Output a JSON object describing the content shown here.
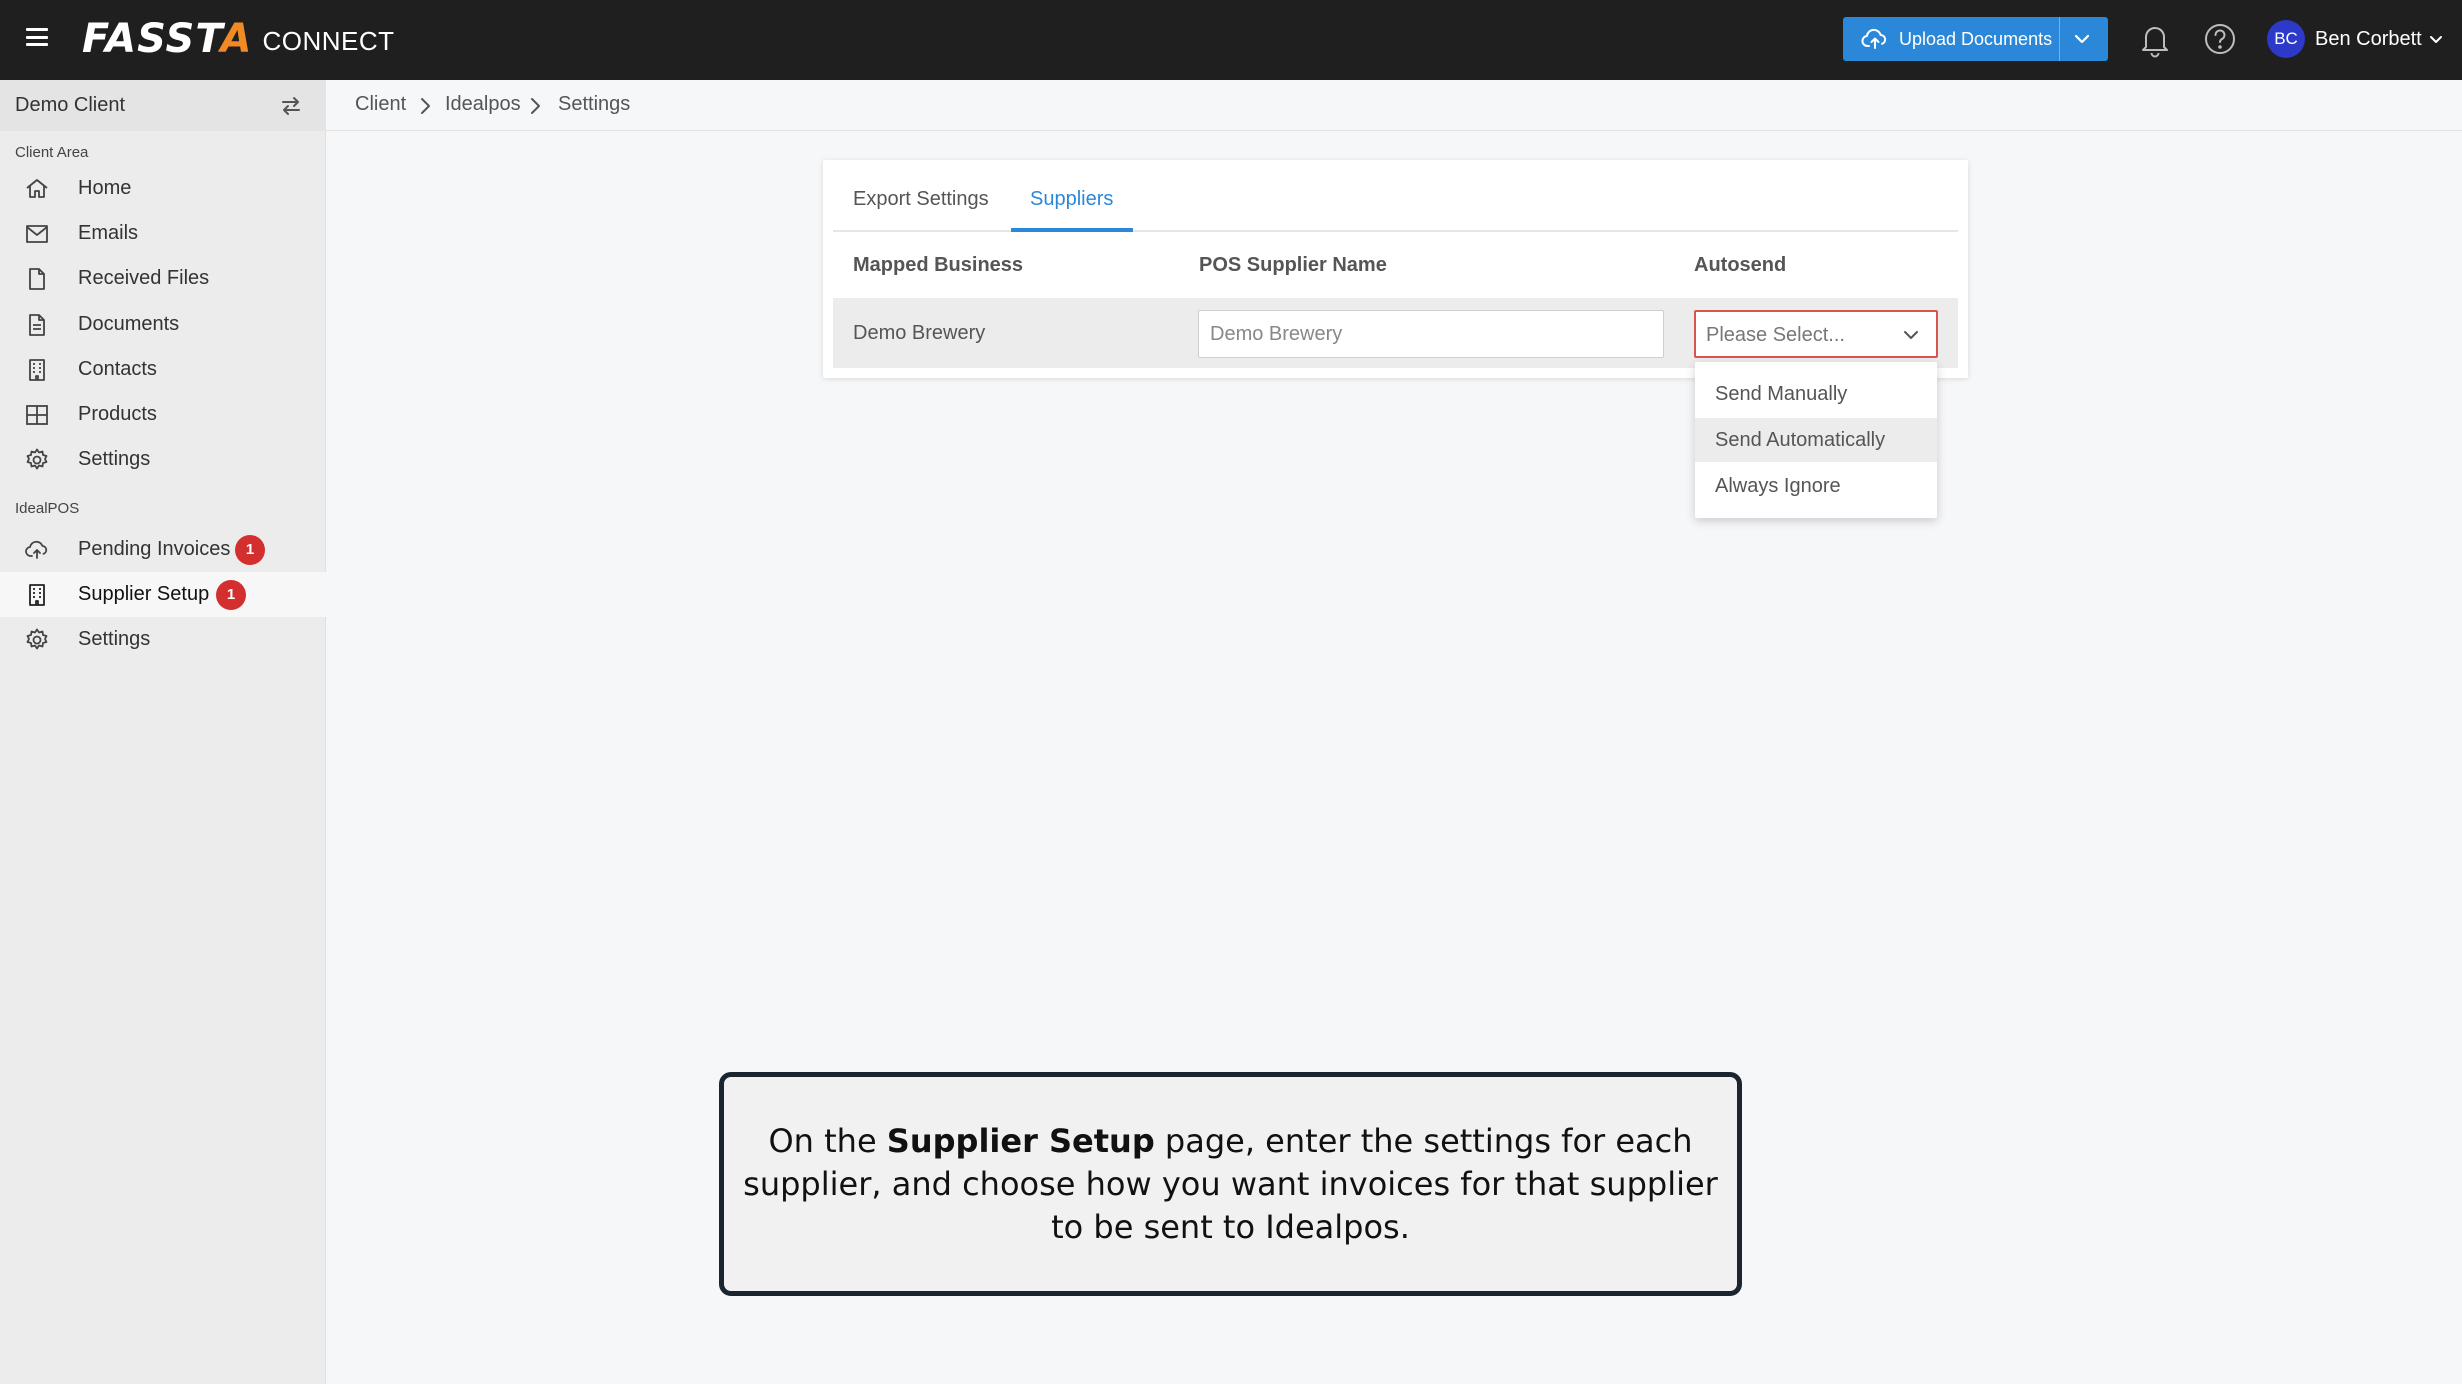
{
  "header": {
    "logo_main_a": "FASST",
    "logo_main_b": "A",
    "logo_sub": "CONNECT",
    "upload_label": "Upload Documents",
    "user_initials": "BC",
    "user_name": "Ben Corbett",
    "colors": {
      "topbar": "#1f1f1f",
      "accent": "#2b88d8",
      "logo_accent": "#f08a24",
      "avatar": "#2c39c9"
    }
  },
  "sidebar": {
    "client_name": "Demo Client",
    "client_area_label": "Client Area",
    "client_items": [
      {
        "label": "Home",
        "icon": "home-icon"
      },
      {
        "label": "Emails",
        "icon": "mail-icon"
      },
      {
        "label": "Received Files",
        "icon": "file-icon"
      },
      {
        "label": "Documents",
        "icon": "document-icon"
      },
      {
        "label": "Contacts",
        "icon": "building-icon"
      },
      {
        "label": "Products",
        "icon": "grid-icon"
      },
      {
        "label": "Settings",
        "icon": "gear-icon"
      }
    ],
    "idealpos_label": "IdealPOS",
    "idealpos_items": [
      {
        "label": "Pending Invoices",
        "icon": "cloud-upload-icon",
        "badge": "1"
      },
      {
        "label": "Supplier Setup",
        "icon": "building-icon",
        "badge": "1",
        "active": true
      },
      {
        "label": "Settings",
        "icon": "gear-icon"
      }
    ]
  },
  "breadcrumb": [
    "Client",
    "Idealpos",
    "Settings"
  ],
  "settings": {
    "tabs": [
      {
        "label": "Export Settings",
        "active": false
      },
      {
        "label": "Suppliers",
        "active": true
      }
    ],
    "columns": [
      "Mapped Business",
      "POS Supplier Name",
      "Autosend"
    ],
    "rows": [
      {
        "mapped_business": "Demo Brewery",
        "pos_supplier_placeholder": "Demo Brewery",
        "autosend": "Please Select..."
      }
    ],
    "autosend_options": [
      "Send Manually",
      "Send Automatically",
      "Always Ignore"
    ],
    "hovered_option": "Send Automatically"
  },
  "callout": {
    "prefix": "On the ",
    "bold": "Supplier Setup",
    "suffix": " page, enter the settings for each supplier, and choose how you want invoices for that supplier to be sent to Idealpos."
  }
}
